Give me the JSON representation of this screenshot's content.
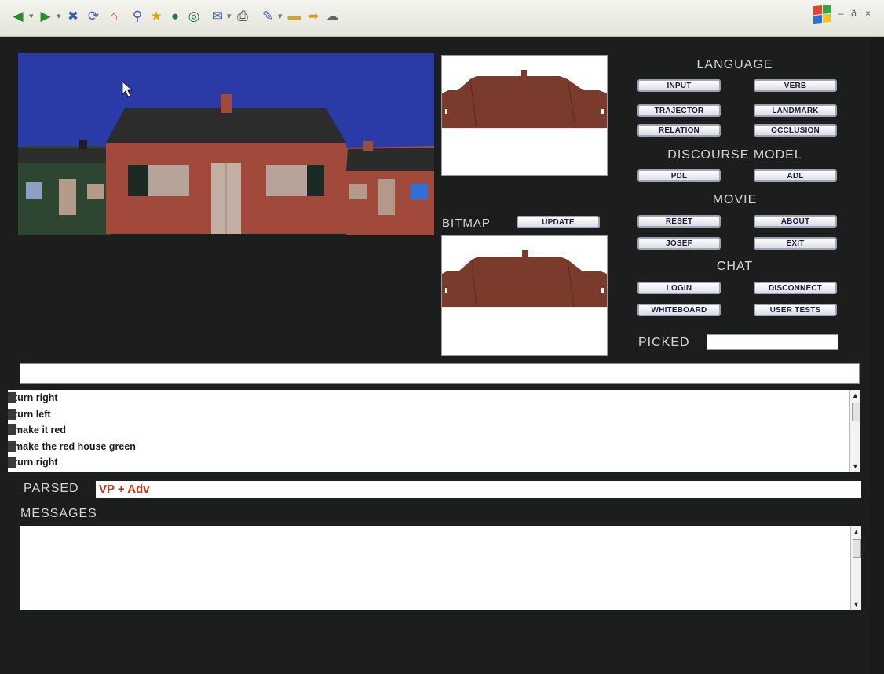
{
  "window": {
    "min_label": "–",
    "restore_label": "ð",
    "close_label": "×"
  },
  "toolbar": {
    "icons": [
      "back-icon",
      "forward-icon",
      "stop-icon",
      "refresh-icon",
      "home-icon",
      "search-icon",
      "favorites-icon",
      "media-icon",
      "history-icon",
      "mail-icon",
      "print-icon",
      "edit-icon",
      "folder-icon",
      "go-icon",
      "messenger-icon"
    ]
  },
  "language": {
    "title": "LANGUAGE",
    "buttons": [
      "INPUT",
      "VERB",
      "TRAJECTOR",
      "LANDMARK",
      "RELATION",
      "OCCLUSION"
    ]
  },
  "discourse": {
    "title": "DISCOURSE MODEL",
    "buttons": [
      "PDL",
      "ADL"
    ]
  },
  "movie": {
    "title": "MOVIE",
    "buttons": [
      "RESET",
      "ABOUT",
      "JOSEF",
      "EXIT"
    ]
  },
  "chat": {
    "title": "CHAT",
    "buttons": [
      "LOGIN",
      "DISCONNECT",
      "WHITEBOARD",
      "USER TESTS"
    ]
  },
  "bitmap": {
    "label": "BITMAP",
    "update_label": "UPDATE"
  },
  "picked": {
    "label": "PICKED",
    "value": ""
  },
  "command": {
    "value": ""
  },
  "history": {
    "items": [
      "turn right",
      "turn left",
      "make it red",
      "make the red house green",
      "turn right"
    ]
  },
  "parsed": {
    "label": "PARSED",
    "value": "VP + Adv"
  },
  "messages": {
    "label": "MESSAGES",
    "value": ""
  },
  "colors": {
    "sky": "#2a3aa6",
    "ground": "#1c1e1e",
    "roof": "#2c2c2c",
    "house_wall": "#a14a3b",
    "side_house_wall": "#2e4532",
    "thumb_house": "#7a3a2c",
    "parsed_text": "#c23a18"
  }
}
